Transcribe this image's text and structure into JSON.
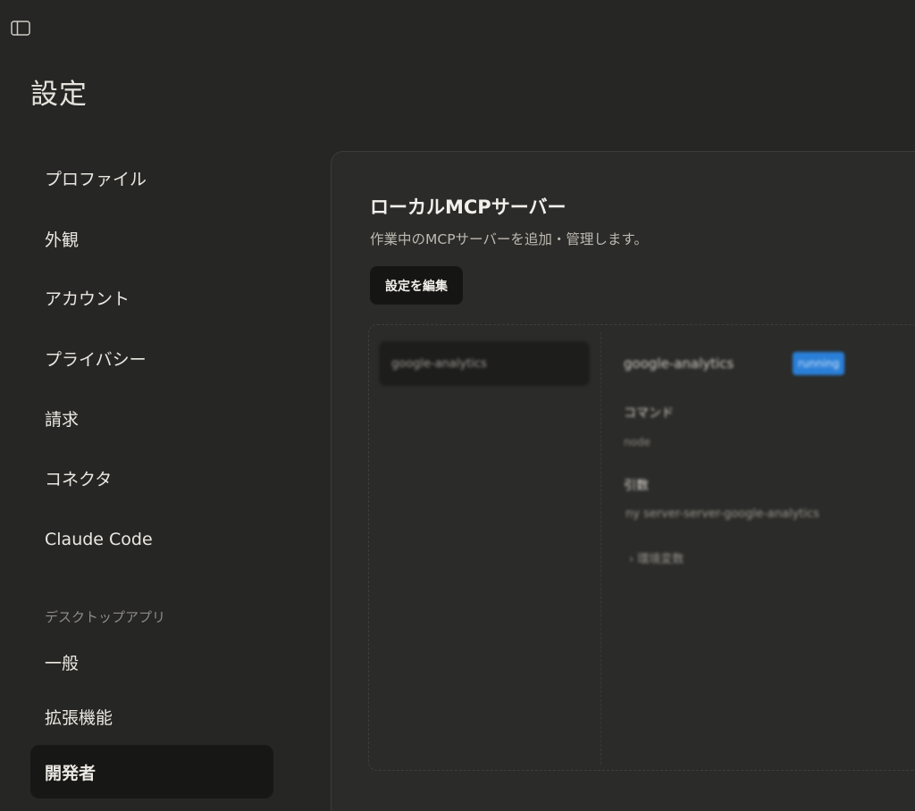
{
  "header": {
    "sidebar_toggle_icon": "sidebar-toggle-icon",
    "page_title": "設定"
  },
  "nav": {
    "items": [
      {
        "label": "プロファイル"
      },
      {
        "label": "外観"
      },
      {
        "label": "アカウント"
      },
      {
        "label": "プライバシー"
      },
      {
        "label": "請求"
      },
      {
        "label": "コネクタ"
      },
      {
        "label": "Claude Code"
      }
    ],
    "section_label": "デスクトップアプリ",
    "desktop_items": [
      {
        "label": "一般"
      },
      {
        "label": "拡張機能"
      },
      {
        "label": "開発者",
        "active": true
      }
    ]
  },
  "main": {
    "section_title": "ローカルMCPサーバー",
    "section_description": "作業中のMCPサーバーを追加・管理します。",
    "edit_button_label": "設定を編集",
    "server_list": [
      {
        "name": "google-analytics"
      }
    ],
    "server_detail": {
      "name": "google-analytics",
      "status": "running",
      "label_1": "コマンド",
      "value_1": "node",
      "label_2": "引数",
      "value_2": "ny server-server-google-analytics",
      "expander": "環境変数"
    }
  },
  "colors": {
    "background": "#262624",
    "panel": "#2b2b29",
    "active_nav": "#171716",
    "button": "#151514",
    "status_badge": "#2a7fd8"
  }
}
